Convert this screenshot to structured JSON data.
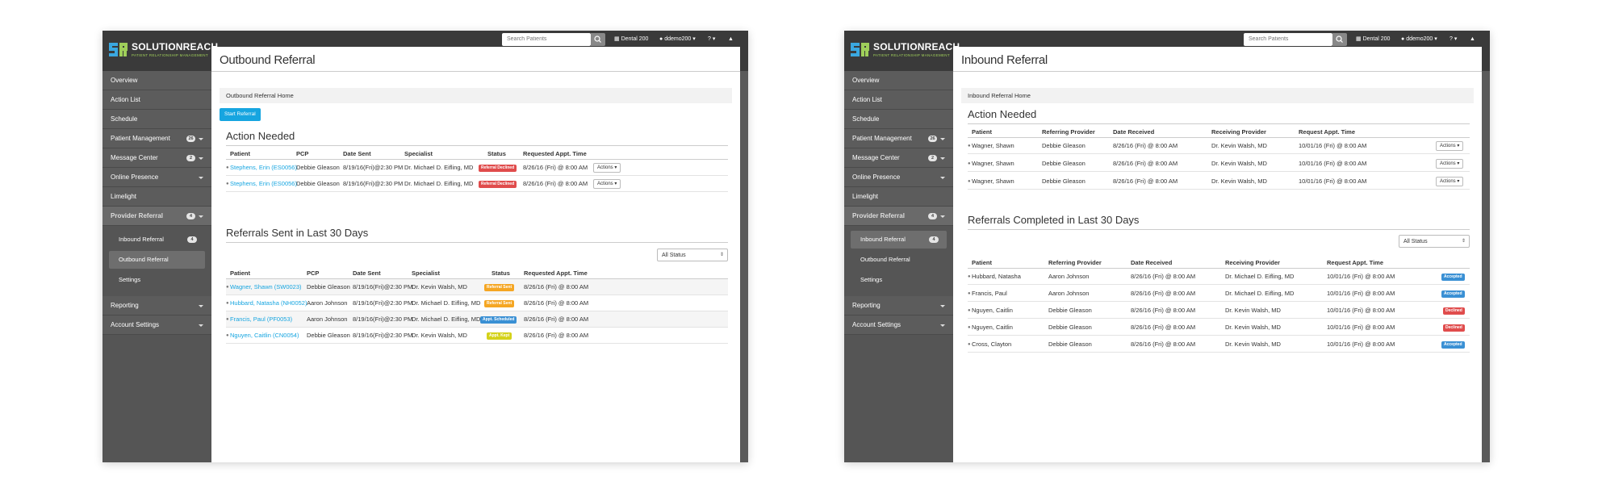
{
  "colors": {
    "accent": "#16a5e0",
    "topbar": "#3a3a3a",
    "sidebar": "#555555",
    "declined": "#e04c4c",
    "sent": "#f5a623",
    "scheduled": "#3a90d4",
    "kept": "#d4d21a",
    "accepted": "#3a90d4"
  },
  "header": {
    "brand": "SOLUTIONREACH",
    "tagline": "PATIENT RELATIONSHIP MANAGEMENT",
    "search_placeholder": "Search Patients",
    "practice": "Dental 200",
    "user": "ddemo200",
    "help": "?"
  },
  "sidebar": {
    "items": [
      {
        "label": "Overview"
      },
      {
        "label": "Action List"
      },
      {
        "label": "Schedule"
      },
      {
        "label": "Patient Management",
        "badge": "26"
      },
      {
        "label": "Message Center",
        "badge": "2"
      },
      {
        "label": "Online Presence"
      },
      {
        "label": "Limelight"
      },
      {
        "label": "Provider Referral",
        "badge": "4"
      },
      {
        "label": "Reporting"
      },
      {
        "label": "Account Settings"
      }
    ],
    "sub_items": [
      {
        "label": "Inbound Referral",
        "badge": "4"
      },
      {
        "label": "Outbound Referral"
      },
      {
        "label": "Settings"
      }
    ]
  },
  "outbound": {
    "title": "Outbound Referral",
    "breadcrumb": "Outbound Referral Home",
    "start_button": "Start Referral",
    "action_title": "Action Needed",
    "action_headers": [
      "Patient",
      "PCP",
      "Date Sent",
      "Specialist",
      "Status",
      "Requested Appt. Time"
    ],
    "action_rows": [
      {
        "patient": "Stephens, Erin (ES0056)",
        "pcp": "Debbie Gleason",
        "date": "8/19/16(Fri)@2:30 PM",
        "specialist": "Dr. Michael D. Eifling, MD",
        "status": "Referral Declined",
        "appt": "8/26/16 (Fri) @ 8:00 AM",
        "actions": "Actions"
      },
      {
        "patient": "Stephens, Erin (ES0056)",
        "pcp": "Debbie Gleason",
        "date": "8/19/16(Fri)@2:30 PM",
        "specialist": "Dr. Michael D. Eifling, MD",
        "status": "Referral Declined",
        "appt": "8/26/16 (Fri) @ 8:00 AM",
        "actions": "Actions"
      }
    ],
    "sent_title": "Referrals Sent in Last 30 Days",
    "filter": "All Status",
    "sent_headers": [
      "Patient",
      "PCP",
      "Date Sent",
      "Specialist",
      "Status",
      "Requested Appt. Time"
    ],
    "sent_rows": [
      {
        "patient": "Wagner, Shawn (SW0023)",
        "pcp": "Debbie Gleason",
        "date": "8/19/16(Fri)@2:30 PM",
        "specialist": "Dr. Kevin Walsh, MD",
        "status": "Referral Sent",
        "appt": "8/26/16 (Fri) @ 8:00 AM"
      },
      {
        "patient": "Hubbard, Natasha (NH0052)",
        "pcp": "Aaron Johnson",
        "date": "8/19/16(Fri)@2:30 PM",
        "specialist": "Dr. Michael D. Eifling, MD",
        "status": "Referral Sent",
        "appt": "8/26/16 (Fri) @ 8:00 AM"
      },
      {
        "patient": "Francis, Paul (PF0053)",
        "pcp": "Aaron Johnson",
        "date": "8/19/16(Fri)@2:30 PM",
        "specialist": "Dr. Michael D. Eifling, MD",
        "status": "Appt. Scheduled",
        "appt": "8/26/16 (Fri) @ 8:00 AM"
      },
      {
        "patient": "Nguyen, Caitlin (CN0054)",
        "pcp": "Debbie Gleason",
        "date": "8/19/16(Fri)@2:30 PM",
        "specialist": "Dr. Kevin Walsh, MD",
        "status": "Appt. Kept",
        "appt": "8/26/16 (Fri) @ 8:00 AM"
      }
    ]
  },
  "inbound": {
    "title": "Inbound Referral",
    "breadcrumb": "Inbound Referral Home",
    "action_title": "Action Needed",
    "action_headers": [
      "Patient",
      "Referring Provider",
      "Date Received",
      "Receiving Provider",
      "Request Appt. Time"
    ],
    "action_rows": [
      {
        "patient": "Wagner, Shawn",
        "referring": "Debbie Gleason",
        "date": "8/26/16 (Fri) @ 8:00 AM",
        "receiving": "Dr. Kevin Walsh, MD",
        "appt": "10/01/16 (Fri) @ 8:00 AM",
        "actions": "Actions"
      },
      {
        "patient": "Wagner, Shawn",
        "referring": "Debbie Gleason",
        "date": "8/26/16 (Fri) @ 8:00 AM",
        "receiving": "Dr. Kevin Walsh, MD",
        "appt": "10/01/16 (Fri) @ 8:00 AM",
        "actions": "Actions"
      },
      {
        "patient": "Wagner, Shawn",
        "referring": "Debbie Gleason",
        "date": "8/26/16 (Fri) @ 8:00 AM",
        "receiving": "Dr. Kevin Walsh, MD",
        "appt": "10/01/16 (Fri) @ 8:00 AM",
        "actions": "Actions"
      }
    ],
    "completed_title": "Referrals Completed in Last 30 Days",
    "filter": "All Status",
    "completed_headers": [
      "Patient",
      "Referring Provider",
      "Date Received",
      "Receiving Provider",
      "Request Appt. Time"
    ],
    "completed_rows": [
      {
        "patient": "Hubbard, Natasha",
        "referring": "Aaron Johnson",
        "date": "8/26/16 (Fri) @ 8:00 AM",
        "receiving": "Dr. Michael D. Eifling, MD",
        "appt": "10/01/16 (Fri) @ 8:00 AM",
        "status": "Accepted"
      },
      {
        "patient": "Francis, Paul",
        "referring": "Aaron Johnson",
        "date": "8/26/16 (Fri) @ 8:00 AM",
        "receiving": "Dr. Michael D. Eifling, MD",
        "appt": "10/01/16 (Fri) @ 8:00 AM",
        "status": "Accepted"
      },
      {
        "patient": "Nguyen, Caitlin",
        "referring": "Debbie Gleason",
        "date": "8/26/16 (Fri) @ 8:00 AM",
        "receiving": "Dr. Kevin Walsh, MD",
        "appt": "10/01/16 (Fri) @ 8:00 AM",
        "status": "Declined"
      },
      {
        "patient": "Nguyen, Caitlin",
        "referring": "Debbie Gleason",
        "date": "8/26/16 (Fri) @ 8:00 AM",
        "receiving": "Dr. Kevin Walsh, MD",
        "appt": "10/01/16 (Fri) @ 8:00 AM",
        "status": "Declined"
      },
      {
        "patient": "Cross, Clayton",
        "referring": "Debbie Gleason",
        "date": "8/26/16 (Fri) @ 8:00 AM",
        "receiving": "Dr. Kevin Walsh, MD",
        "appt": "10/01/16 (Fri) @ 8:00 AM",
        "status": "Accepted"
      }
    ]
  }
}
